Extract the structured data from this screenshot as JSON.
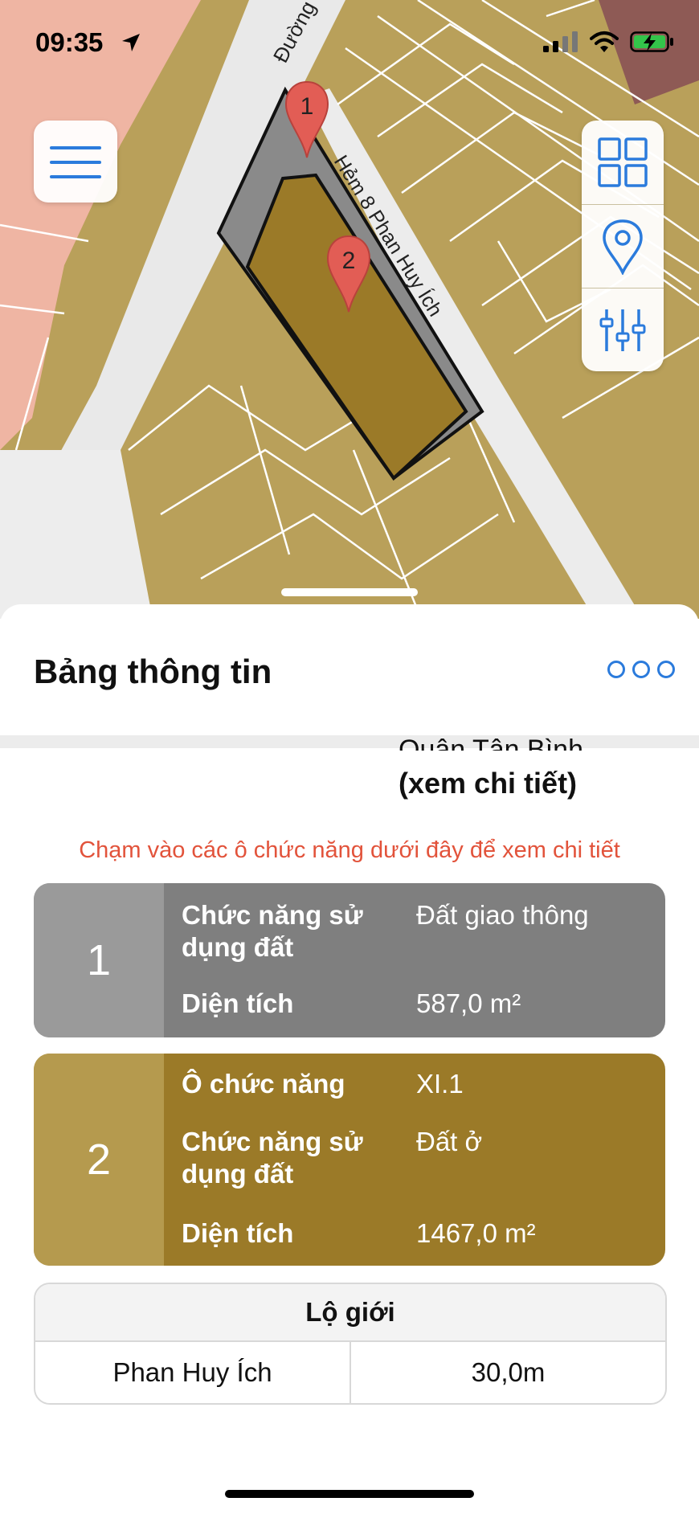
{
  "status_bar": {
    "time": "09:35",
    "icons": [
      "location-arrow-icon",
      "cellular-signal-icon",
      "wifi-icon",
      "battery-charging-icon"
    ]
  },
  "map": {
    "road_label_1": "Đường",
    "road_label_2": "Hẻm 8 Phan Huy Ích",
    "marker_1": "1",
    "marker_2": "2",
    "colors": {
      "residential": "#b9a05a",
      "transport": "#8a8a8a",
      "selected_parcel": "#9b7a28",
      "commercial": "#efb5a3",
      "road": "#eeeeee"
    }
  },
  "map_controls": {
    "menu_icon": "hamburger-menu-icon",
    "tools": [
      "grid-layers-icon",
      "map-pin-icon",
      "sliders-filter-icon"
    ]
  },
  "sheet": {
    "title": "Bảng thông tin",
    "partial_district": "Quận Tân Bình",
    "detail_link": "(xem chi tiết)",
    "hint": "Chạm vào các ô chức năng dưới đây để xem chi tiết"
  },
  "cards": [
    {
      "number": "1",
      "color": "#7f7f7f",
      "rows": [
        {
          "label": "Chức năng sử dụng đất",
          "value": "Đất giao thông"
        },
        {
          "label": "Diện tích",
          "value": "587,0 m²"
        }
      ]
    },
    {
      "number": "2",
      "color": "#9b7a28",
      "rows": [
        {
          "label": "Ô chức năng",
          "value": "XI.1"
        },
        {
          "label": "Chức năng sử dụng đất",
          "value": "Đất ở"
        },
        {
          "label": "Diện tích",
          "value": "1467,0 m²"
        }
      ]
    }
  ],
  "road_boundary": {
    "header": "Lộ giới",
    "road_name": "Phan Huy Ích",
    "width": "30,0m"
  },
  "accent_color": "#2b7bdc",
  "hint_color": "#e2533b"
}
